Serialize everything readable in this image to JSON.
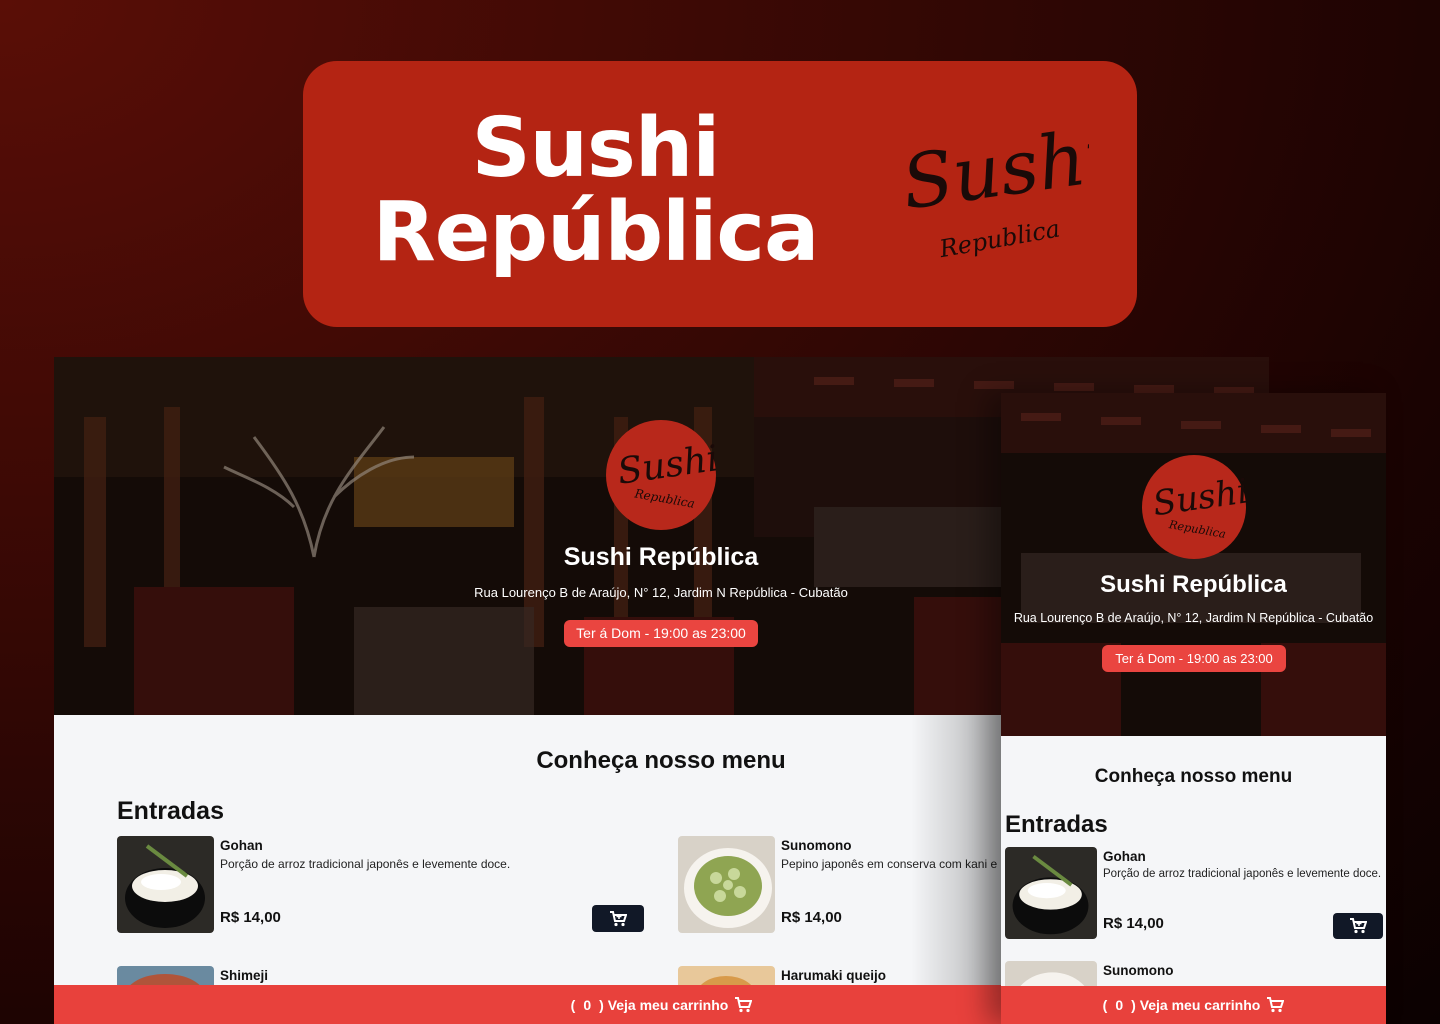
{
  "banner": {
    "title_line1": "Sushi",
    "title_line2": "República",
    "logo_word": "Sushi",
    "logo_sub": "Republica",
    "color": "#b42413"
  },
  "restaurant": {
    "name": "Sushi República",
    "address": "Rua Lourenço B de Araújo, N° 12, Jardim N República - Cubatão",
    "hours": "Ter á Dom - 19:00 as 23:00",
    "logo_word": "Sushi",
    "logo_sub": "Republica"
  },
  "menu": {
    "title": "Conheça nosso menu",
    "category": "Entradas",
    "items": [
      {
        "name": "Gohan",
        "description": "Porção de arroz tradicional japonês e levemente doce.",
        "price": "R$ 14,00",
        "image": "rice-bowl-image"
      },
      {
        "name": "Sunomono",
        "description": "Pepino japonês em conserva com kani e",
        "price": "R$ 14,00",
        "image": "cucumber-salad-image"
      },
      {
        "name": "Shimeji",
        "description": "",
        "price": "",
        "image": "shimeji-image"
      },
      {
        "name": "Harumaki queijo",
        "description": "",
        "price": "",
        "image": "harumaki-image"
      }
    ],
    "mobile_items": [
      {
        "name": "Gohan",
        "description": "Porção de arroz tradicional japonês e levemente doce.",
        "price": "R$ 14,00"
      },
      {
        "name": "Sunomono"
      }
    ]
  },
  "cart": {
    "open_paren": "(",
    "count": "0",
    "label": ") Veja meu carrinho",
    "icon": "cart-icon"
  },
  "colors": {
    "accent_red": "#e8413c",
    "dark_button": "#111827",
    "page_bg": "#f5f6f8"
  }
}
